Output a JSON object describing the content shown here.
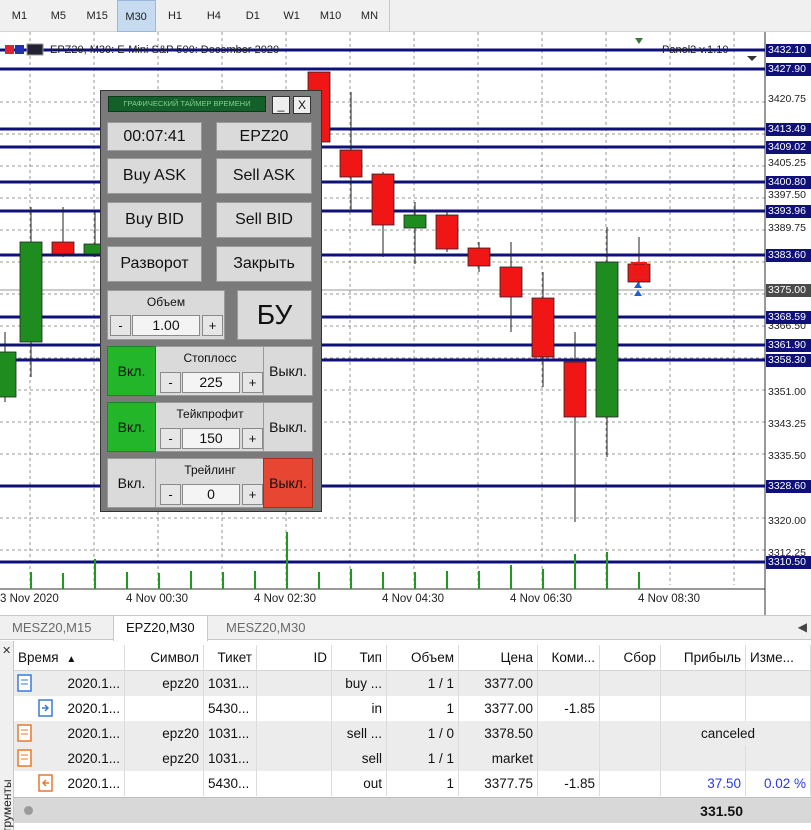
{
  "timeframes": [
    "M1",
    "M5",
    "M15",
    "M30",
    "H1",
    "H4",
    "D1",
    "W1",
    "M10",
    "MN"
  ],
  "active_timeframe": "M30",
  "chart": {
    "title": "EPZ20, M30:  E-Mini S&P 500: December 2020",
    "panel_version": "Panel2 v.1.10",
    "price_scale": [
      "3420.75",
      "3405.25",
      "3397.50",
      "3389.75",
      "3366.50",
      "3351.00",
      "3343.25",
      "3335.50",
      "3320.00",
      "3312.25"
    ],
    "level_labels": [
      "3432.10",
      "3427.90",
      "3413.49",
      "3409.02",
      "3400.80",
      "3393.96",
      "3383.60",
      "3368.59",
      "3361.90",
      "3358.30",
      "3328.60",
      "3310.50"
    ],
    "current_price": "3375.00",
    "time_labels": [
      "3 Nov 2020",
      "4 Nov 00:30",
      "4 Nov 02:30",
      "4 Nov 04:30",
      "4 Nov 06:30",
      "4 Nov 08:30"
    ],
    "colors": {
      "bull": "#1e8c1e",
      "bear": "#f01616",
      "level": "#10107a",
      "grid": "#7a7a7a",
      "volume": "#1e9a1e"
    }
  },
  "panel": {
    "title": "ГРАФИЧЕСКИЙ ТАЙМЕР ВРЕМЕНИ",
    "minimize": "_",
    "close": "X",
    "timer": "00:07:41",
    "symbol": "EPZ20",
    "buy_ask": "Buy ASK",
    "sell_ask": "Sell ASK",
    "buy_bid": "Buy BID",
    "sell_bid": "Sell BID",
    "reverse": "Разворот",
    "close_all": "Закрыть",
    "volume_label": "Объем",
    "volume_value": "1.00",
    "breakeven": "БУ",
    "minus": "-",
    "plus": "+",
    "on": "Вкл.",
    "off": "Выкл.",
    "stoploss_label": "Стоплосс",
    "stoploss_value": "225",
    "takeprofit_label": "Тейкпрофит",
    "takeprofit_value": "150",
    "trailing_label": "Трейлинг",
    "trailing_value": "0"
  },
  "tabs": [
    "MESZ20,M15",
    "EPZ20,M30",
    "MESZ20,M30"
  ],
  "active_tab": "EPZ20,M30",
  "table": {
    "side_label": "трументы",
    "columns": [
      "Время",
      "Символ",
      "Тикет",
      "ID",
      "Тип",
      "Объем",
      "Цена",
      "Коми...",
      "Сбор",
      "Прибыль",
      "Измe..."
    ],
    "rows": [
      {
        "time": "2020.1...",
        "symbol": "epz20",
        "ticket": "1031...",
        "id": "",
        "type": "buy ...",
        "volume": "1 / 1",
        "price": "3377.00",
        "commission": "",
        "fee": "",
        "profit": "",
        "change": ""
      },
      {
        "time": "2020.1...",
        "symbol": "",
        "ticket": "5430...",
        "id": "",
        "type": "in",
        "volume": "1",
        "price": "3377.00",
        "commission": "-1.85",
        "fee": "",
        "profit": "",
        "change": ""
      },
      {
        "time": "2020.1...",
        "symbol": "epz20",
        "ticket": "1031...",
        "id": "",
        "type": "sell ...",
        "volume": "1 / 0",
        "price": "3378.50",
        "commission": "",
        "fee": "",
        "profit": "canceled",
        "change": ""
      },
      {
        "time": "2020.1...",
        "symbol": "epz20",
        "ticket": "1031...",
        "id": "",
        "type": "sell",
        "volume": "1 / 1",
        "price": "market",
        "commission": "",
        "fee": "",
        "profit": "",
        "change": ""
      },
      {
        "time": "2020.1...",
        "symbol": "",
        "ticket": "5430...",
        "id": "",
        "type": "out",
        "volume": "1",
        "price": "3377.75",
        "commission": "-1.85",
        "fee": "",
        "profit": "37.50",
        "change": "0.02 %"
      }
    ],
    "total": "331.50"
  }
}
